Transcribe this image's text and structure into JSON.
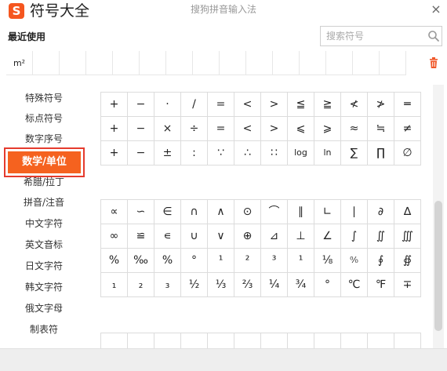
{
  "window": {
    "logo_glyph": "S",
    "title": "符号大全",
    "ime_name": "搜狗拼音输入法",
    "close_glyph": "×"
  },
  "recent": {
    "label": "最近使用",
    "items": [
      "m²",
      "",
      "",
      "",
      "",
      "",
      "",
      "",
      "",
      "",
      "",
      "",
      "",
      "",
      ""
    ]
  },
  "search": {
    "placeholder": "搜索符号",
    "value": ""
  },
  "sidebar": {
    "items": [
      {
        "label": "特殊符号"
      },
      {
        "label": "标点符号"
      },
      {
        "label": "数字序号"
      },
      {
        "label": "数学/单位",
        "active": true
      },
      {
        "label": "希腊/拉丁"
      },
      {
        "label": "拼音/注音"
      },
      {
        "label": "中文字符"
      },
      {
        "label": "英文音标"
      },
      {
        "label": "日文字符"
      },
      {
        "label": "韩文字符"
      },
      {
        "label": "俄文字母"
      },
      {
        "label": "制表符"
      }
    ]
  },
  "grid1": {
    "rows": [
      [
        "+",
        "−",
        "·",
        "/",
        "=",
        "<",
        ">",
        "≦",
        "≧",
        "≮",
        "≯",
        "═"
      ],
      [
        "+",
        "−",
        "×",
        "÷",
        "=",
        "<",
        ">",
        "⩽",
        "⩾",
        "≈",
        "≒",
        "≠"
      ],
      [
        "+",
        "−",
        "±",
        ":",
        "∵",
        "∴",
        "∷",
        "log",
        "ln",
        "∑",
        "∏",
        "∅"
      ]
    ]
  },
  "grid2": {
    "rows": [
      [
        "∝",
        "∽",
        "∈",
        "∩",
        "∧",
        "⊙",
        "⌒",
        "∥",
        "∟",
        "∣",
        "∂",
        "∆"
      ],
      [
        "∞",
        "≌",
        "∊",
        "∪",
        "∨",
        "⊕",
        "⊿",
        "⊥",
        "∠",
        "∫",
        "∬",
        "∭"
      ],
      [
        "%",
        "‰",
        "%",
        "°",
        "¹",
        "²",
        "³",
        "¹",
        "⅛",
        "⁰⁄₀",
        "∮",
        "∯"
      ],
      [
        "₁",
        "₂",
        "₃",
        "½",
        "⅓",
        "⅔",
        "¼",
        "¾",
        "°",
        "℃",
        "℉",
        "∓"
      ]
    ]
  },
  "grid3": {
    "rows": [
      [
        "",
        "",
        "",
        "",
        "",
        "",
        "",
        "",
        "",
        "",
        "",
        ""
      ]
    ]
  },
  "icons": {
    "search": "search-icon",
    "trash": "trash-icon",
    "close": "close-icon"
  },
  "colors": {
    "accent": "#f5621f",
    "active_border": "#e53b2e",
    "trash": "#f0582a",
    "grid_line": "#dcdcdc"
  }
}
